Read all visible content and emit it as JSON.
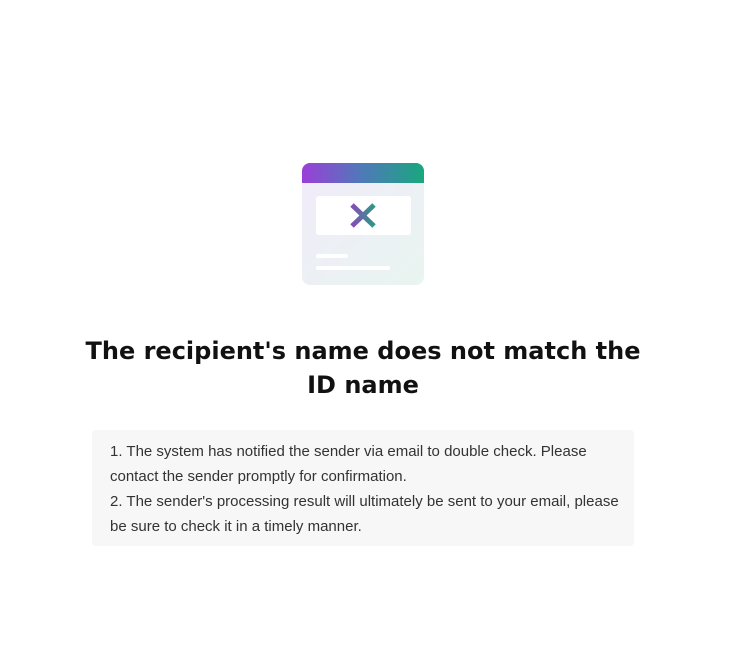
{
  "illustration": {
    "icon": "browser-window-error-icon",
    "gradient_start": "#9b3fd8",
    "gradient_end": "#19a77e",
    "cross_color_left": "#8a4bb8",
    "cross_color_right": "#2b9a86"
  },
  "title": "The recipient's name does not match the ID name",
  "notice": {
    "line1": "1. The system has notified the sender via email to double check. Please contact the sender promptly for confirmation.",
    "line2": "2. The sender's processing result will ultimately be sent to your email, please be sure to check it in a timely manner."
  }
}
